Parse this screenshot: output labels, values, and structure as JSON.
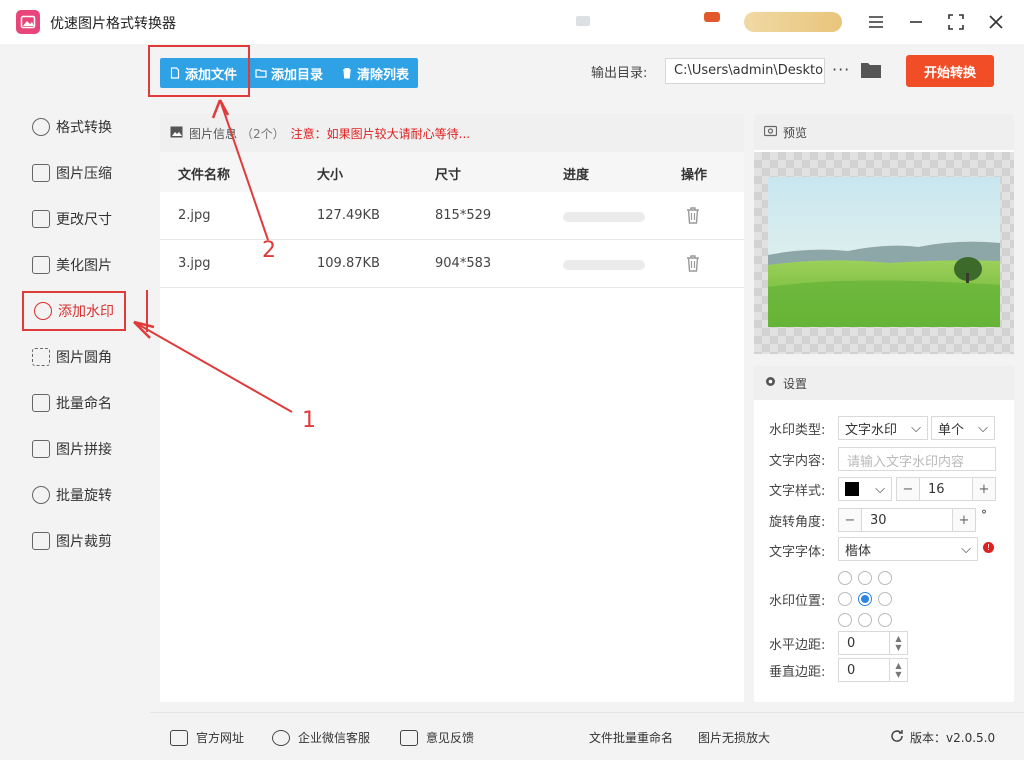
{
  "app": {
    "title": "优速图片格式转换器"
  },
  "toolbar": {
    "add_file": "添加文件",
    "add_folder": "添加目录",
    "clear_list": "清除列表",
    "output_label": "输出目录:",
    "output_path": "C:\\Users\\admin\\Deskto",
    "more": "···",
    "start": "开始转换"
  },
  "sidebar": {
    "items": [
      {
        "label": "格式转换"
      },
      {
        "label": "图片压缩"
      },
      {
        "label": "更改尺寸"
      },
      {
        "label": "美化图片"
      },
      {
        "label": "添加水印"
      },
      {
        "label": "图片圆角"
      },
      {
        "label": "批量命名"
      },
      {
        "label": "图片拼接"
      },
      {
        "label": "批量旋转"
      },
      {
        "label": "图片裁剪"
      }
    ],
    "active_index": 4
  },
  "list": {
    "info_label": "图片信息",
    "count": "（2个）",
    "warning": "注意：如果图片较大请耐心等待...",
    "headers": {
      "name": "文件名称",
      "size": "大小",
      "dims": "尺寸",
      "progress": "进度",
      "action": "操作"
    },
    "rows": [
      {
        "name": "2.jpg",
        "size": "127.49KB",
        "dims": "815*529",
        "progress": 0
      },
      {
        "name": "3.jpg",
        "size": "109.87KB",
        "dims": "904*583",
        "progress": 0
      }
    ]
  },
  "preview": {
    "title": "预览"
  },
  "settings": {
    "title": "设置",
    "watermark_type_label": "水印类型:",
    "watermark_type": "文字水印",
    "watermark_mode": "单个",
    "text_label": "文字内容:",
    "text_placeholder": "请输入文字水印内容",
    "style_label": "文字样式:",
    "font_size": "16",
    "angle_label": "旋转角度:",
    "angle": "30",
    "angle_unit": "°",
    "font_label": "文字字体:",
    "font": "楷体",
    "position_label": "水印位置:",
    "position_selected": "center",
    "h_margin_label": "水平边距:",
    "h_margin": "0",
    "v_margin_label": "垂直边距:",
    "v_margin": "0",
    "text_color": "#000000"
  },
  "footer": {
    "website": "官方网址",
    "wechat": "企业微信客服",
    "feedback": "意见反馈",
    "batch_rename": "文件批量重命名",
    "lossless_enlarge": "图片无损放大",
    "version_label": "版本：",
    "version": "v2.0.5.0"
  },
  "annotations": {
    "step1": "1",
    "step2": "2"
  },
  "colors": {
    "accent_blue": "#2fa2e6",
    "start_orange": "#f14d26",
    "annot_red": "#e03b3b"
  }
}
